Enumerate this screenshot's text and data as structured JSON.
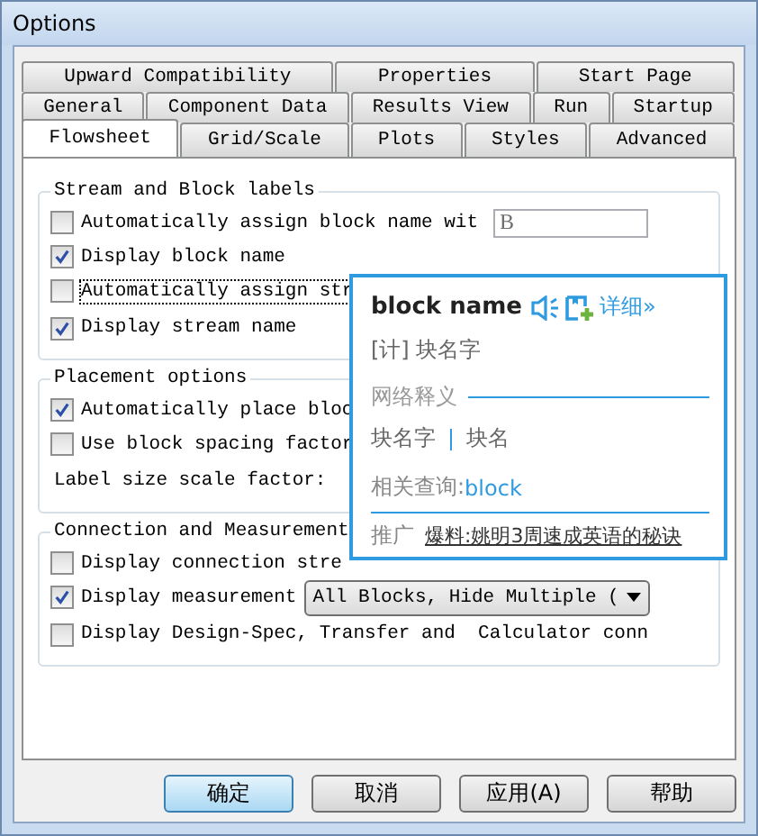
{
  "window": {
    "title": "Options"
  },
  "tab_rows": [
    [
      {
        "label": "Upward Compatibility",
        "selected": false
      },
      {
        "label": "Properties",
        "selected": false
      },
      {
        "label": "Start Page",
        "selected": false
      }
    ],
    [
      {
        "label": "General",
        "selected": false
      },
      {
        "label": "Component Data",
        "selected": false
      },
      {
        "label": "Results View",
        "selected": false
      },
      {
        "label": "Run",
        "selected": false
      },
      {
        "label": "Startup",
        "selected": false
      }
    ],
    [
      {
        "label": "Flowsheet",
        "selected": true
      },
      {
        "label": "Grid/Scale",
        "selected": false
      },
      {
        "label": "Plots",
        "selected": false
      },
      {
        "label": "Styles",
        "selected": false
      },
      {
        "label": "Advanced",
        "selected": false
      }
    ]
  ],
  "groups": [
    {
      "title": "Stream and Block labels",
      "rows": [
        {
          "kind": "checkbox",
          "label": "Automatically assign block name wit",
          "checked": false,
          "focused": false,
          "field": {
            "value": "B"
          }
        },
        {
          "kind": "checkbox",
          "label": "Display block name",
          "checked": true,
          "focused": false
        },
        {
          "kind": "checkbox",
          "label": "Automatically assign str",
          "checked": false,
          "focused": true
        },
        {
          "kind": "checkbox",
          "label": "Display stream name",
          "checked": true,
          "focused": false
        }
      ]
    },
    {
      "title": "Placement options",
      "rows": [
        {
          "kind": "checkbox",
          "label": "Automatically place bloc",
          "checked": true,
          "focused": false
        },
        {
          "kind": "checkbox",
          "label": "Use block spacing factor",
          "checked": false,
          "focused": false
        },
        {
          "kind": "text",
          "label": "Label size scale factor:"
        }
      ]
    },
    {
      "title": "Connection and Measurement",
      "rows": [
        {
          "kind": "checkbox",
          "label": "Display connection stre",
          "checked": false,
          "focused": false
        },
        {
          "kind": "checkbox",
          "label": "Display measurement",
          "checked": true,
          "focused": false,
          "dropdown": {
            "value": "All Blocks, Hide Multiple ("
          }
        },
        {
          "kind": "checkbox",
          "label": "Display Design-Spec, Transfer and  Calculator conn",
          "checked": false,
          "focused": false
        }
      ]
    }
  ],
  "buttons": [
    {
      "label": "确定",
      "default": true
    },
    {
      "label": "取消",
      "default": false
    },
    {
      "label": "应用(A)",
      "default": false
    },
    {
      "label": "帮助",
      "default": false
    }
  ],
  "dictionary_popup": {
    "word": "block name",
    "detail_link": "详细»",
    "phonetic": "[计] 块名字",
    "section_title": "网络释义",
    "meanings": [
      "块名字",
      "块名"
    ],
    "related_label": "相关查询:",
    "related_link": "block",
    "promo_label": "推广",
    "promo_link": "爆料:姚明3周速成英语的秘诀"
  }
}
